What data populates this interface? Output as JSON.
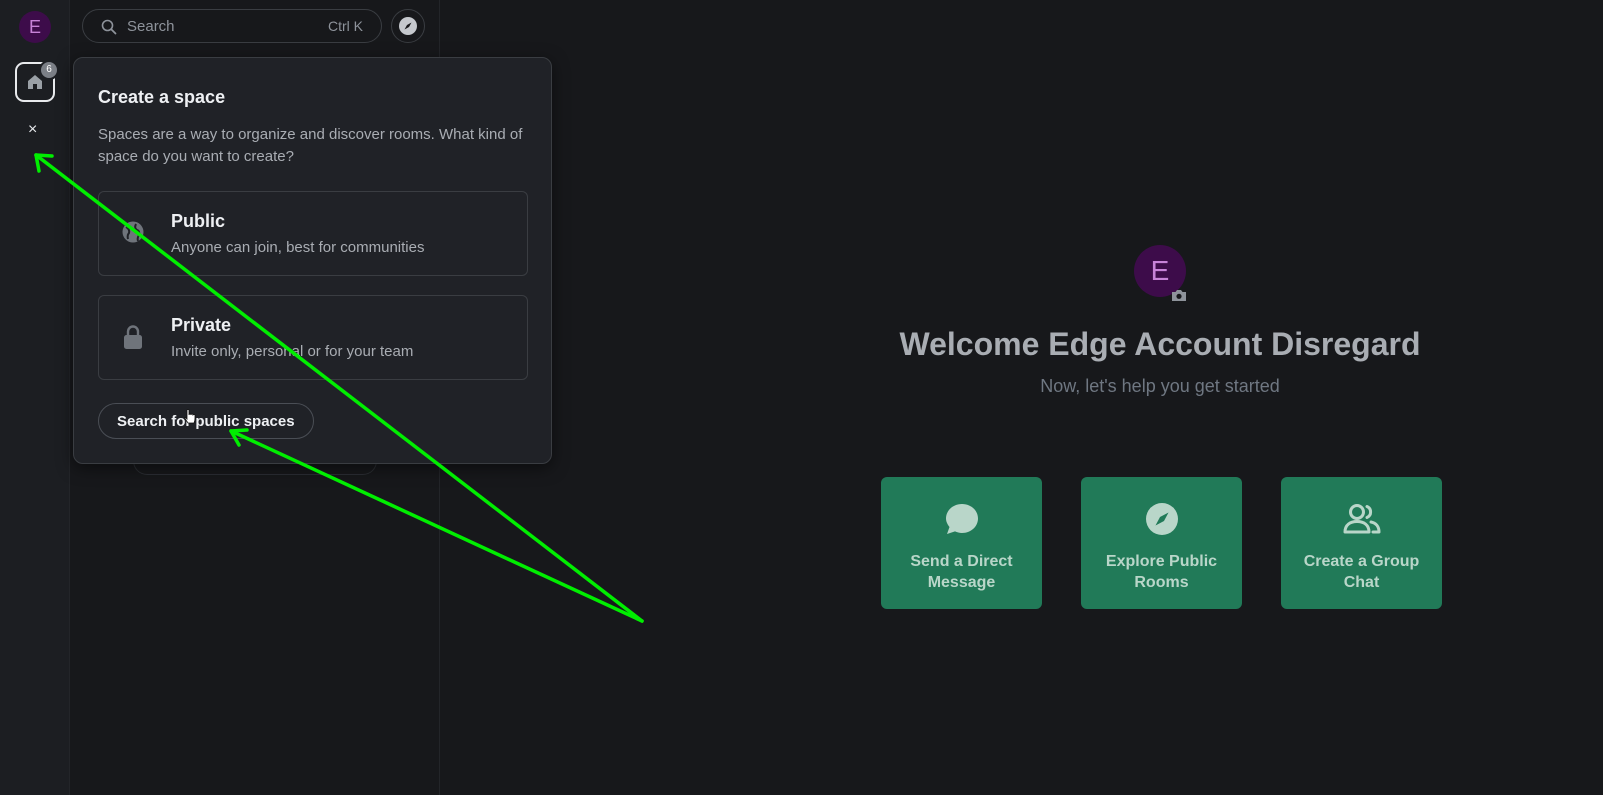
{
  "rail": {
    "avatar_letter": "E",
    "home_badge": "6",
    "close_glyph": "×"
  },
  "search": {
    "placeholder": "Search",
    "shortcut": "Ctrl K"
  },
  "popup": {
    "title": "Create a space",
    "description": "Spaces are a way to organize and discover rooms. What kind of space do you want to create?",
    "options": [
      {
        "title": "Public",
        "subtitle": "Anyone can join, best for communities",
        "icon": "globe-icon"
      },
      {
        "title": "Private",
        "subtitle": "Invite only, personal or for your team",
        "icon": "lock-icon"
      }
    ],
    "search_public_label": "Search for public spaces"
  },
  "main": {
    "avatar_letter": "E",
    "title": "Welcome Edge Account Disregard",
    "subtitle": "Now, let's help you get started",
    "actions": [
      {
        "label": "Send a Direct Message",
        "icon": "chat-bubble-icon"
      },
      {
        "label": "Explore Public Rooms",
        "icon": "compass-icon"
      },
      {
        "label": "Create a Group Chat",
        "icon": "group-icon"
      }
    ]
  },
  "colors": {
    "background": "#17181b",
    "accent_green": "#217a58",
    "annotation_arrow": "#00ee00",
    "avatar_bg": "#3d0c4a",
    "avatar_fg": "#c783d8"
  }
}
